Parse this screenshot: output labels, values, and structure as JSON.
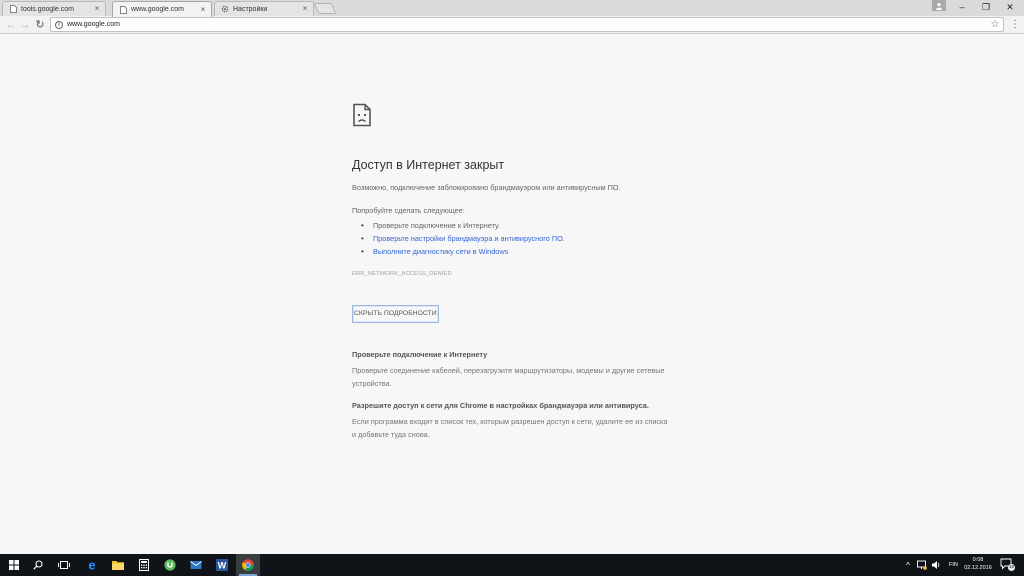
{
  "tabs": [
    {
      "title": "tools.google.com",
      "icon": "page-icon",
      "active": false
    },
    {
      "title": "www.google.com",
      "icon": "page-icon",
      "active": true
    },
    {
      "title": "Настройки",
      "icon": "gear-icon",
      "active": false
    }
  ],
  "window_controls": {
    "minimize": "–",
    "restore": "❐",
    "close": "✕"
  },
  "toolbar": {
    "back": "←",
    "forward": "→",
    "reload": "↻",
    "url": "www.google.com",
    "info": "i",
    "star": "☆",
    "menu": "⋮"
  },
  "error": {
    "title": "Доступ в Интернет закрыт",
    "description": "Возможно, подключение заблокировано брандмауэром или антивирусным ПО.",
    "try_title": "Попробуйте сделать следующее:",
    "suggestions": [
      {
        "text": "Проверьте подключение к Интернету.",
        "link": false
      },
      {
        "text": "Проверьте настройки брандмауэра и антивирусного ПО.",
        "link": true
      },
      {
        "text": "Выполните диагностику сети в Windows",
        "link": true
      }
    ],
    "code": "ERR_NETWORK_ACCESS_DENIED",
    "details_button": "СКРЫТЬ ПОДРОБНОСТИ",
    "details": [
      {
        "heading": "Проверьте подключение к Интернету",
        "text": "Проверьте соединение кабелей, перезагрузите маршрутизаторы, модемы и другие сетевые устройства."
      },
      {
        "heading": "Разрешите доступ к сети для Chrome в настройках брандмауэра или антивируса.",
        "text": "Если программа входит в список тех, которым разрешен доступ к сети, удалите ее из списка и добавьте туда снова."
      }
    ]
  },
  "taskbar": {
    "apps": [
      "start-icon",
      "search-icon",
      "task-view-icon",
      "edge-icon",
      "file-explorer-icon",
      "calculator-icon",
      "utorrent-icon",
      "mail-icon",
      "word-icon",
      "chrome-icon"
    ],
    "tray": {
      "chevron": "^",
      "language": "FIN"
    },
    "clock": {
      "time": "0:08",
      "date": "02.12.2016"
    },
    "notification_count": "19"
  },
  "colors": {
    "link": "#3367d6",
    "accent": "#7ea6d8",
    "taskbar": "#101418"
  }
}
